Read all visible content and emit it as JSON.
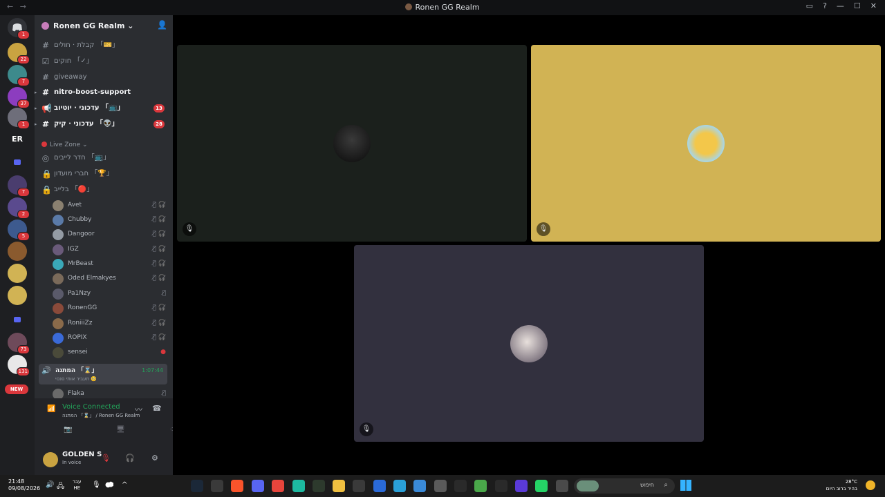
{
  "window": {
    "title": "Ronen GG Realm",
    "nav_back": "←",
    "nav_forward": "→"
  },
  "guilds": {
    "badges": [
      "1",
      "22",
      "7",
      "37",
      "1",
      "7",
      "2",
      "5",
      "73",
      "131"
    ],
    "new_label": "NEW"
  },
  "server": {
    "name": "Ronen GG Realm",
    "chevron": "⌄"
  },
  "channels": [
    {
      "label": "קבלת · חולים 「🎫」",
      "count": ""
    },
    {
      "label": "חוקים 「✓」",
      "count": ""
    },
    {
      "label": "giveaway",
      "count": ""
    },
    {
      "label": "nitro-boost-support",
      "count": ""
    },
    {
      "label": "עדכוני · יוטיוב 「📺」",
      "count": "13"
    },
    {
      "label": "עדכוני · קיק 「👽」",
      "count": "28"
    }
  ],
  "category": {
    "label": "Live Zone ⌄"
  },
  "voice_channels": [
    {
      "label": "חדר לייבים 「📺」"
    },
    {
      "label": "חברי מועדון 「🏆」"
    },
    {
      "label": "בלייב 「🔴」"
    }
  ],
  "voice_users": [
    {
      "name": "Avet"
    },
    {
      "name": "Chubby"
    },
    {
      "name": "Dangoor"
    },
    {
      "name": "IGZ"
    },
    {
      "name": "MrBeast"
    },
    {
      "name": "Oded Elmakyes"
    },
    {
      "name": "Pa1Nzy"
    },
    {
      "name": "RonenGG"
    },
    {
      "name": "RoniiiZz"
    },
    {
      "name": "ROPIX"
    },
    {
      "name": "sensei"
    }
  ],
  "active_channel": {
    "label": "המתנה 「⌛」",
    "time": "1:07:44",
    "sub": "תעביר אותי סנסי 🥺"
  },
  "partial_user": {
    "name": "Flaka"
  },
  "voice": {
    "status": "Voice Connected",
    "location": "המתנה 「⌛」 / Ronen GG Realm"
  },
  "user": {
    "name": "GOLDEN S",
    "status": "In voice"
  },
  "taskbar": {
    "time": "21:48",
    "date": "09/08/2026",
    "lang": "עבר",
    "lang2": "HE",
    "search_placeholder": "חיפוש",
    "temp": "28°C",
    "weather": "בהיר ברוב היום"
  },
  "colors": {
    "tile1_bg": "#1b201c",
    "tile2_bg": "#d1b354",
    "tile3_bg": "#32303e",
    "accent_green": "#23a55a",
    "badge_red": "#da373c"
  }
}
